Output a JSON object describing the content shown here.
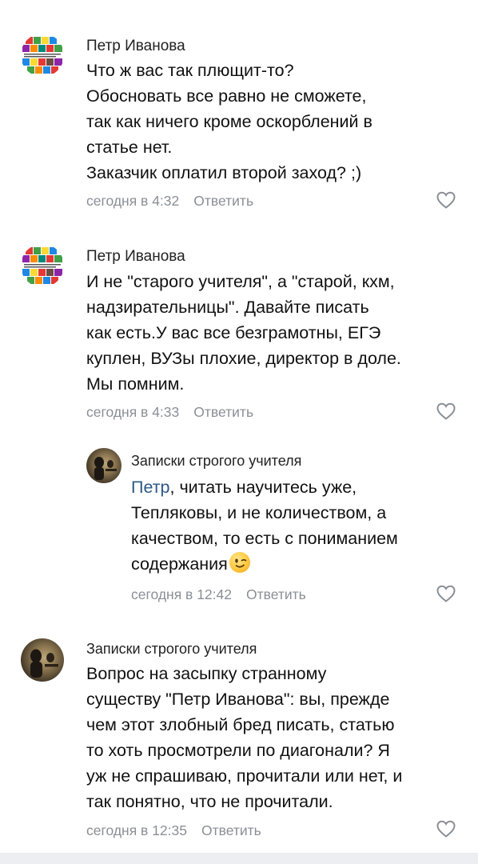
{
  "comments": [
    {
      "author": "Петр Иванова",
      "lines": [
        "Что ж вас так плющит-то?",
        "Обосновать все равно не сможете,",
        "так как ничего кроме оскорблений в",
        "статье нет.",
        "Заказчик оплатил второй заход? ;)"
      ],
      "time": "сегодня в 4:32",
      "reply_label": "Ответить",
      "avatar_icon": "collage-avatar"
    },
    {
      "author": "Петр Иванова",
      "lines": [
        "И не \"старого учителя\", а \"старой, кхм,",
        "надзирательницы\". Давайте писать",
        "как есть.У вас все безграмотны, ЕГЭ",
        "куплен, ВУЗы плохие, директор в доле.",
        "Мы помним."
      ],
      "time": "сегодня в 4:33",
      "reply_label": "Ответить",
      "avatar_icon": "collage-avatar"
    },
    {
      "author": "Записки строгого учителя",
      "mention": "Петр",
      "first_line_rest": ", читать научитесь уже,",
      "lines": [
        "Тепляковы, и не количеством, а",
        "качеством, то есть с пониманием",
        "содержания"
      ],
      "emoji": "winking-face-emoji",
      "time": "сегодня в 12:42",
      "reply_label": "Ответить",
      "avatar_icon": "photo-avatar"
    },
    {
      "author": "Записки строгого учителя",
      "lines": [
        "Вопрос на засыпку странному",
        "существу \"Петр Иванова\": вы, прежде",
        "чем этот злобный бред писать, статью",
        "то хоть просмотрели по диагонали? Я",
        "уж не спрашиваю, прочитали или нет, и",
        "так понятно, что не прочитали."
      ],
      "time": "сегодня в 12:35",
      "reply_label": "Ответить",
      "avatar_icon": "photo-avatar"
    }
  ],
  "icons": {
    "like": "heart-outline-icon"
  },
  "colors": {
    "mention": "#2a5885",
    "meta": "#8a8f96",
    "text": "#111111"
  }
}
